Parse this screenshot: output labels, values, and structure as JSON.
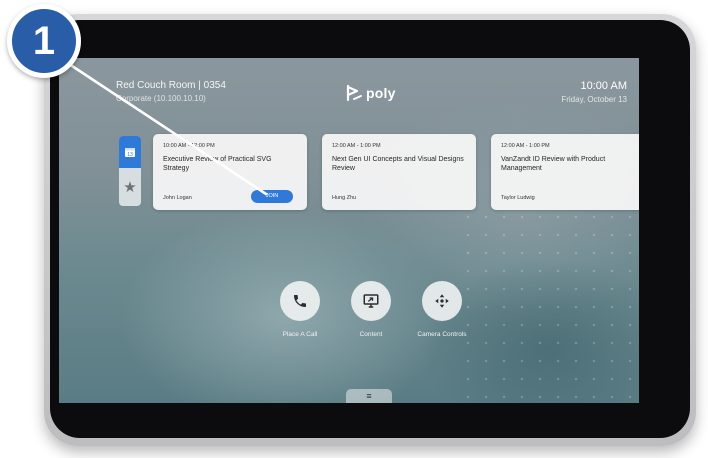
{
  "header": {
    "room_name": "Red Couch Room | 0354",
    "room_ip": "Corporate (10.100.10.10)",
    "brand": "poly",
    "time": "10:00 AM",
    "date": "Friday, October 13"
  },
  "sidebar": {
    "calendar_day": "13"
  },
  "meetings": [
    {
      "time": "10:00 AM - 12:00 PM",
      "title": "Executive Review of Practical SVG Strategy",
      "organizer": "John Logan",
      "join_label": "JOIN"
    },
    {
      "time": "12:00 AM - 1:00 PM",
      "title": "Next Gen UI Concepts and Visual Designs Review",
      "organizer": "Hung Zhu"
    },
    {
      "time": "12:00 AM - 1:00 PM",
      "title": "VanZandt ID Review with Product Management",
      "organizer": "Taylor Ludwig"
    }
  ],
  "actions": [
    {
      "label": "Place A Call",
      "icon": "phone-icon"
    },
    {
      "label": "Content",
      "icon": "content-share-icon"
    },
    {
      "label": "Camera Controls",
      "icon": "camera-controls-icon"
    }
  ],
  "bottom_handle": {
    "icon": "menu-handle-icon",
    "glyph": "≡"
  },
  "callout": {
    "number": "1"
  },
  "colors": {
    "accent": "#2f7ad8",
    "callout_badge": "#2a5da8",
    "bezel": "#0c0c0e"
  }
}
